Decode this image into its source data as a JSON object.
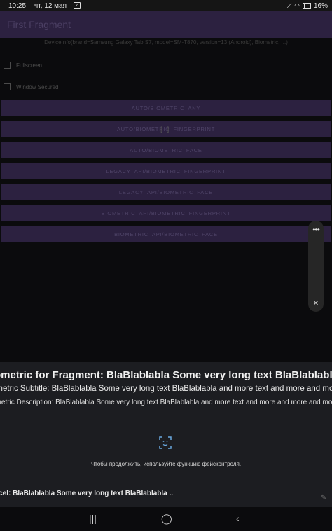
{
  "status": {
    "time": "10:25",
    "date": "чт, 12 мая",
    "battery": "16%"
  },
  "appbar": {
    "title": "First Fragment"
  },
  "info_text": "DeviceInfo(brand=Samsung Galaxy Tab S7, model=SM-T870, version=13 (Android), Biometric, ...)",
  "checkboxes": [
    {
      "label": "Fullscreen"
    },
    {
      "label": "Window Secured"
    }
  ],
  "buttons": [
    "AUTO/BIOMETRIC_ANY",
    "AUTO/BIOMETRIC_FINGERPRINT",
    "AUTO/BIOMETRIC_FACE",
    "LEGACY_API/BIOMETRIC_FINGERPRINT",
    "LEGACY_API/BIOMETRIC_FACE",
    "BIOMETRIC_API/BIOMETRIC_FINGERPRINT",
    "BIOMETRIC_API/BIOMETRIC_FACE"
  ],
  "sheet": {
    "title": "ometric for Fragment: BlaBlablabla Some very long text BlaBlablabla and..",
    "subtitle": "ometric Subtitle: BlaBlablabla Some very long text BlaBlablabla and more text and more and more t",
    "description": "ometric Description: BlaBlablabla Some very long text BlaBlablabla and more text and more and more and more",
    "hint": "Чтобы продолжить, используйте функцию фейсконтроля.",
    "cancel": "ncel: BlaBlablabla Some very long text BlaBlablabla .."
  },
  "icons": {
    "face_scan": "face-scan-icon",
    "more": "more-dots-icon",
    "touch_off": "touch-off-icon"
  }
}
